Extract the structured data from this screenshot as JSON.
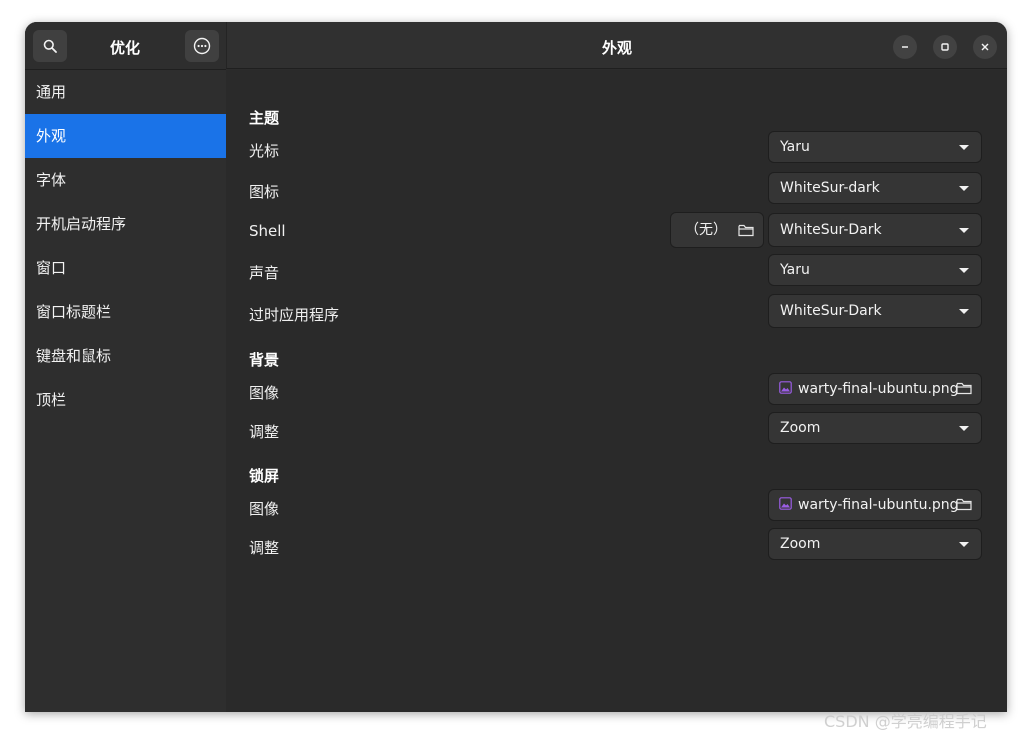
{
  "sidebar": {
    "title": "优化",
    "search_icon": "search-icon",
    "menu_icon": "more-options-icon",
    "items": [
      {
        "label": "通用",
        "active": false
      },
      {
        "label": "外观",
        "active": true
      },
      {
        "label": "字体",
        "active": false
      },
      {
        "label": "开机启动程序",
        "active": false
      },
      {
        "label": "窗口",
        "active": false
      },
      {
        "label": "窗口标题栏",
        "active": false
      },
      {
        "label": "键盘和鼠标",
        "active": false
      },
      {
        "label": "顶栏",
        "active": false
      }
    ]
  },
  "header": {
    "title": "外观",
    "window_buttons": [
      "minimize-icon",
      "maximize-icon",
      "close-icon"
    ]
  },
  "theme": {
    "section_title": "主题",
    "cursor": {
      "label": "光标",
      "value": "Yaru"
    },
    "icons": {
      "label": "图标",
      "value": "WhiteSur-dark"
    },
    "shell": {
      "label": "Shell",
      "value": "WhiteSur-Dark",
      "file_value": "（无）"
    },
    "sound": {
      "label": "声音",
      "value": "Yaru"
    },
    "legacy": {
      "label": "过时应用程序",
      "value": "WhiteSur-Dark"
    }
  },
  "background": {
    "section_title": "背景",
    "image": {
      "label": "图像",
      "value": "warty-final-ubuntu.png"
    },
    "adjust": {
      "label": "调整",
      "value": "Zoom"
    }
  },
  "lockscreen": {
    "section_title": "锁屏",
    "image": {
      "label": "图像",
      "value": "warty-final-ubuntu.png"
    },
    "adjust": {
      "label": "调整",
      "value": "Zoom"
    }
  },
  "watermark": "CSDN @学亮编程手记",
  "colors": {
    "accent": "#1a73e8",
    "window_bg": "#2a2a2a",
    "sidebar_bg": "#2e2e2e",
    "image_icon": "#9b5de5"
  }
}
